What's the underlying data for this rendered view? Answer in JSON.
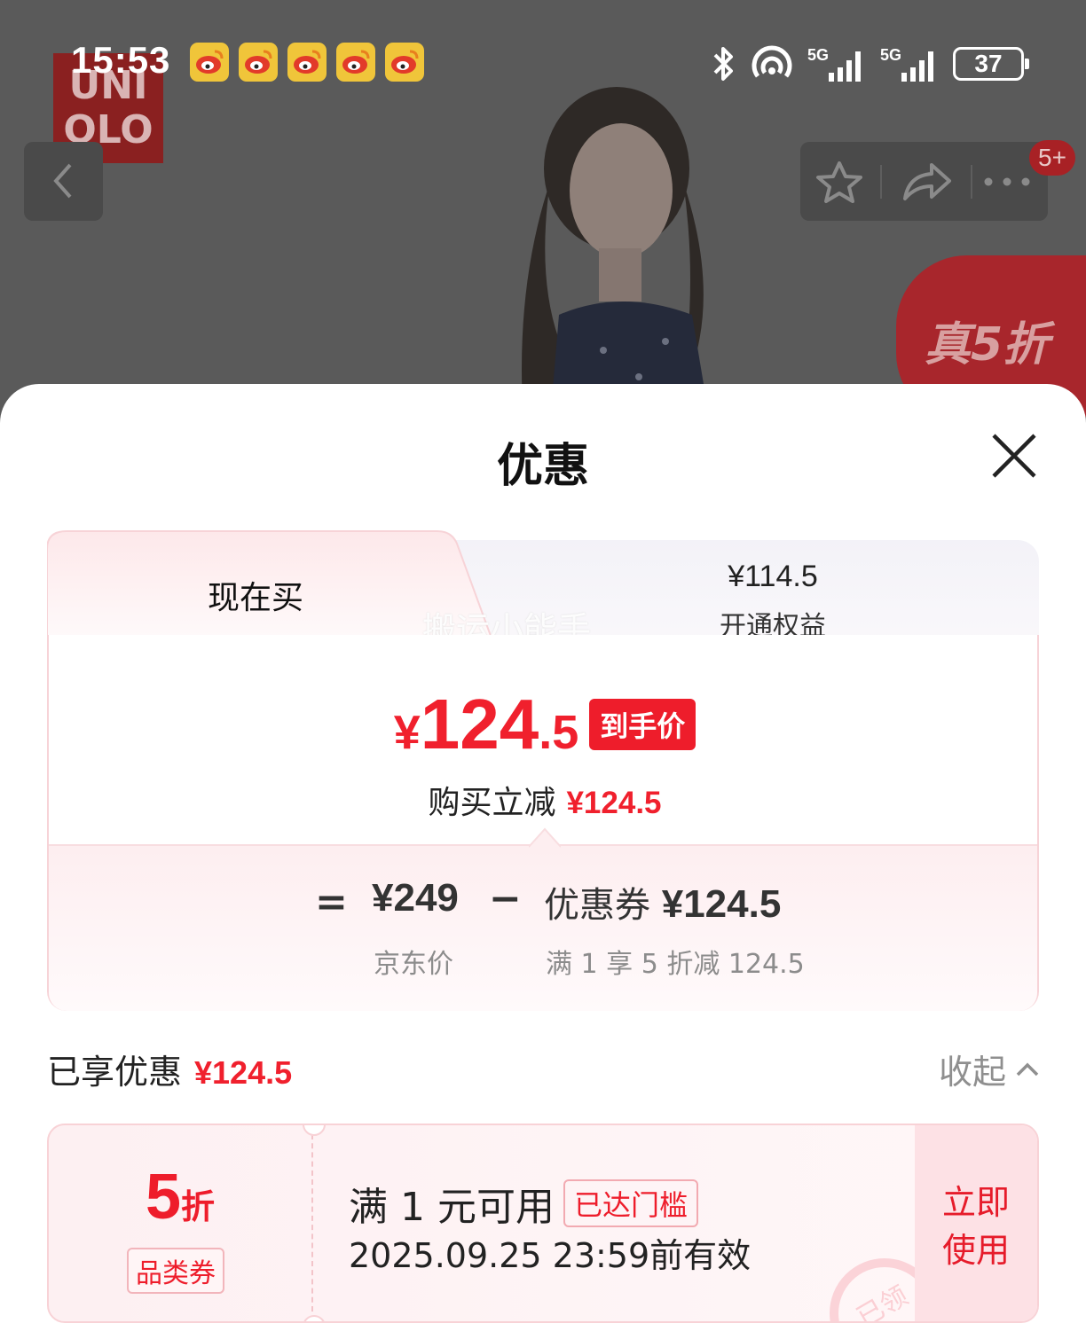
{
  "status_bar": {
    "time": "15:53",
    "battery": "37",
    "signal_label_1": "5G",
    "signal_label_2": "5G"
  },
  "background": {
    "brand_logo": "UNIQLO",
    "promo_badge": "真5折",
    "notification_count": "5+"
  },
  "sheet": {
    "title": "优惠",
    "tabs": {
      "active_label": "现在买",
      "other_price": "¥114.5",
      "other_label": "开通权益"
    },
    "watermark": "搬运小能手",
    "final_price": {
      "yen": "¥",
      "integer": "124",
      "decimal": ".5",
      "tag": "到手价"
    },
    "reduce": {
      "label": "购买立减",
      "amount": "¥124.5"
    },
    "calc": {
      "equals": "=",
      "base_price": "¥249",
      "base_label": "京东价",
      "minus": "−",
      "coupon_label_prefix": "优惠券",
      "coupon_amount": "¥124.5",
      "coupon_desc": "满 1 享 5 折减 124.5"
    },
    "enjoyed": {
      "label": "已享优惠",
      "amount": "¥124.5",
      "collapse_label": "收起"
    },
    "coupon": {
      "discount_num": "5",
      "discount_unit": "折",
      "type": "品类券",
      "condition": "满 1 元可用",
      "reached": "已达门槛",
      "validity": "2025.09.25 23:59前有效",
      "use_line1": "立即",
      "use_line2": "使用",
      "stamp": "已领"
    }
  },
  "colors": {
    "accent_red": "#f0202d",
    "pink_border": "#f8d2d6",
    "overlay": "#5a5a5a"
  }
}
